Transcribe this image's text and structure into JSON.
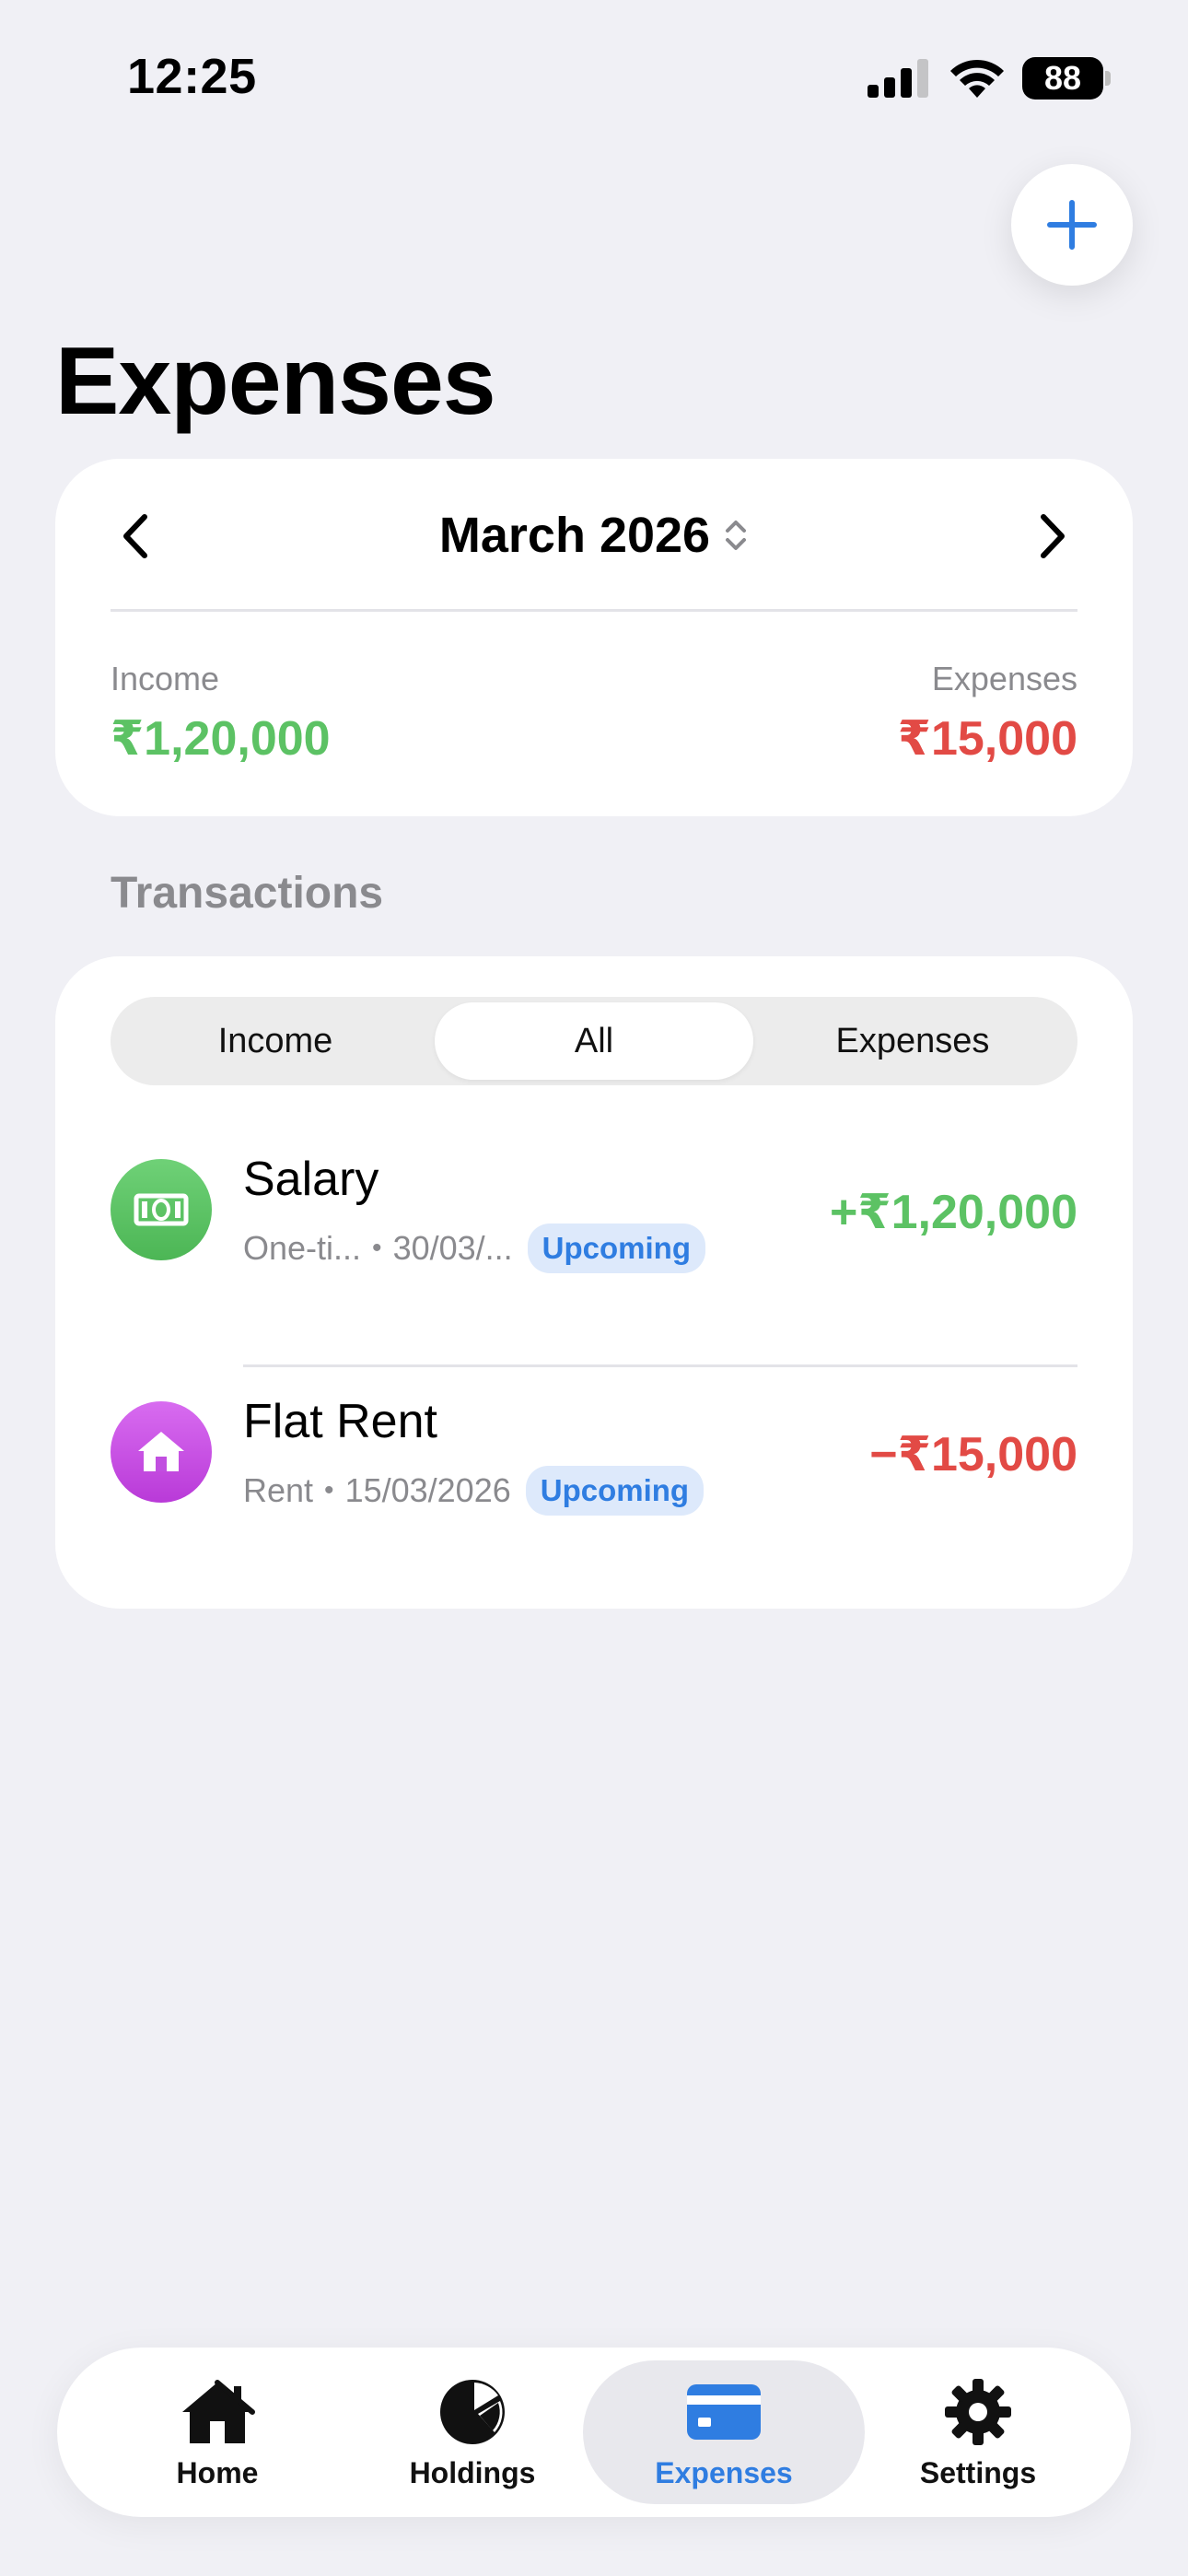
{
  "status_bar": {
    "time": "12:25",
    "battery": "88",
    "icons": [
      "signal-icon",
      "wifi-icon",
      "battery-icon"
    ]
  },
  "header": {
    "title": "Expenses",
    "add_icon": "plus-icon"
  },
  "summary": {
    "month": "March 2026",
    "income_label": "Income",
    "income_value": "₹1,20,000",
    "expense_label": "Expenses",
    "expense_value": "₹15,000"
  },
  "transactions": {
    "heading": "Transactions",
    "segments": [
      "Income",
      "All",
      "Expenses"
    ],
    "selected_segment": "All",
    "items": [
      {
        "name": "Salary",
        "category": "One-ti...",
        "date": "30/03/...",
        "badge": "Upcoming",
        "amount": "+₹1,20,000",
        "icon": "banknote-icon"
      },
      {
        "name": "Flat Rent",
        "category": "Rent",
        "date": "15/03/2026",
        "badge": "Upcoming",
        "amount": "−₹15,000",
        "icon": "house-icon"
      }
    ],
    "separator": "•"
  },
  "tab_bar": {
    "tabs": [
      {
        "label": "Home",
        "icon": "house-icon"
      },
      {
        "label": "Holdings",
        "icon": "pie-chart-icon"
      },
      {
        "label": "Expenses",
        "icon": "credit-card-icon"
      },
      {
        "label": "Settings",
        "icon": "gear-icon"
      }
    ],
    "active": "Expenses"
  },
  "colors": {
    "accent": "#2f7de1",
    "income": "#5cc264",
    "expense": "#e24a45",
    "background": "#f0f0f5"
  }
}
